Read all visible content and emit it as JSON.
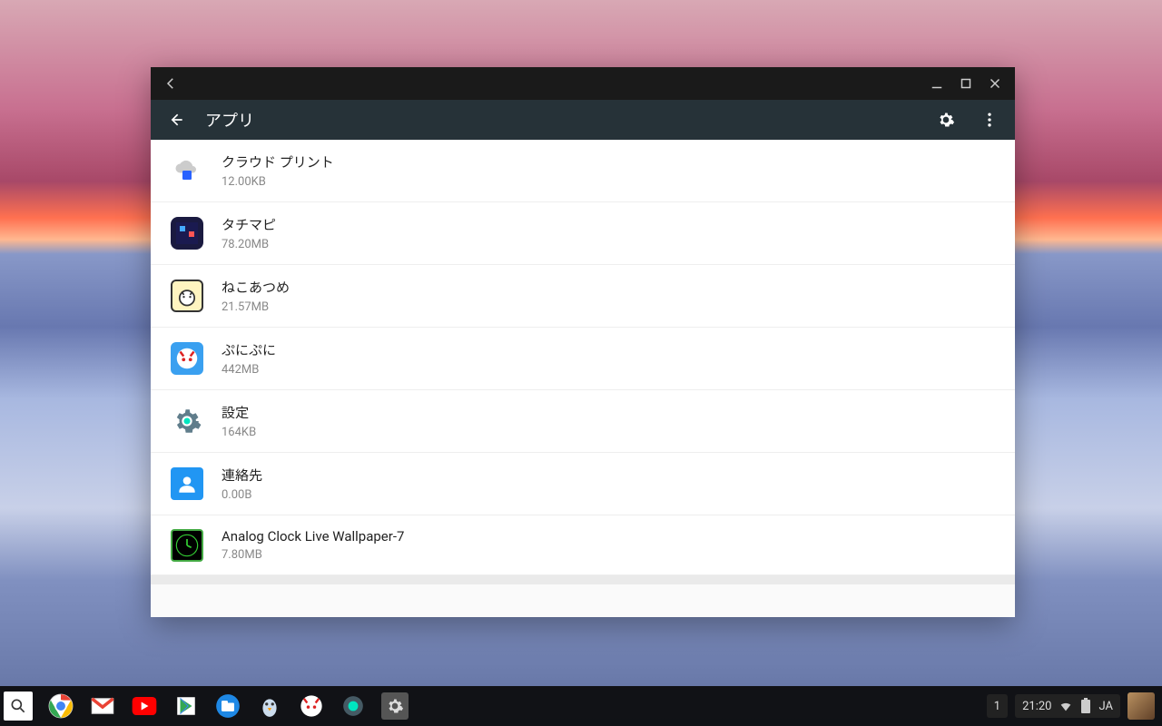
{
  "window": {
    "page_title": "アプリ"
  },
  "apps": [
    {
      "name": "クラウド プリント",
      "size": "12.00KB",
      "icon": "cloudprint-icon"
    },
    {
      "name": "タチマピ",
      "size": "78.20MB",
      "icon": "tachimapi-icon"
    },
    {
      "name": "ねこあつめ",
      "size": "21.57MB",
      "icon": "nekoatsume-icon"
    },
    {
      "name": "ぷにぷに",
      "size": "442MB",
      "icon": "punipuni-icon"
    },
    {
      "name": "設定",
      "size": "164KB",
      "icon": "settings-app-icon"
    },
    {
      "name": "連絡先",
      "size": "0.00B",
      "icon": "contacts-app-icon"
    },
    {
      "name": "Analog Clock Live Wallpaper-7",
      "size": "7.80MB",
      "icon": "analog-clock-icon"
    }
  ],
  "taskbar": {
    "notification_count": "1",
    "clock": "21:20",
    "ime": "JA",
    "icons": [
      "search-icon",
      "chrome-icon",
      "gmail-icon",
      "youtube-icon",
      "play-store-icon",
      "files-icon",
      "penguin-icon",
      "punipuni-shelf-icon",
      "camera-shelf-icon",
      "settings-shelf-icon"
    ]
  }
}
